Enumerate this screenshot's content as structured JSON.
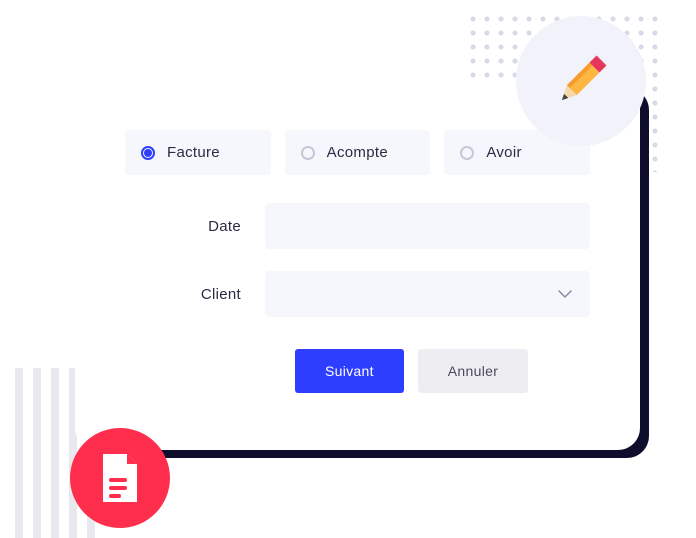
{
  "type_options": [
    {
      "label": "Facture",
      "selected": true
    },
    {
      "label": "Acompte",
      "selected": false
    },
    {
      "label": "Avoir",
      "selected": false
    }
  ],
  "fields": {
    "date_label": "Date",
    "client_label": "Client"
  },
  "buttons": {
    "next": "Suivant",
    "cancel": "Annuler"
  }
}
